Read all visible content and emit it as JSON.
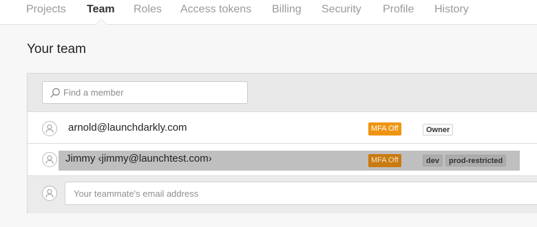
{
  "nav": {
    "tabs": [
      {
        "label": "Projects",
        "active": false
      },
      {
        "label": "Team",
        "active": true
      },
      {
        "label": "Roles",
        "active": false
      },
      {
        "label": "Access tokens",
        "active": false
      },
      {
        "label": "Billing",
        "active": false
      },
      {
        "label": "Security",
        "active": false
      },
      {
        "label": "Profile",
        "active": false
      },
      {
        "label": "History",
        "active": false
      }
    ]
  },
  "page": {
    "title": "Your team"
  },
  "search": {
    "placeholder": "Find a member",
    "value": ""
  },
  "members": [
    {
      "display": "arnold@launchdarkly.com",
      "mfa_badge": "MFA Off",
      "roles": [
        "Owner"
      ],
      "highlighted": false
    },
    {
      "display": "Jimmy ‹jimmy@launchtest.com›",
      "mfa_badge": "MFA Off",
      "roles": [
        "dev",
        "prod-restricted"
      ],
      "highlighted": true
    }
  ],
  "invite": {
    "placeholder": "Your teammate's email address",
    "value": ""
  },
  "colors": {
    "mfa_badge": "#ef9412",
    "row_highlight": "#bfbfbf",
    "panel_bg": "#e9e9e9"
  },
  "icons": {
    "search": "search-icon",
    "avatar": "user-icon"
  }
}
